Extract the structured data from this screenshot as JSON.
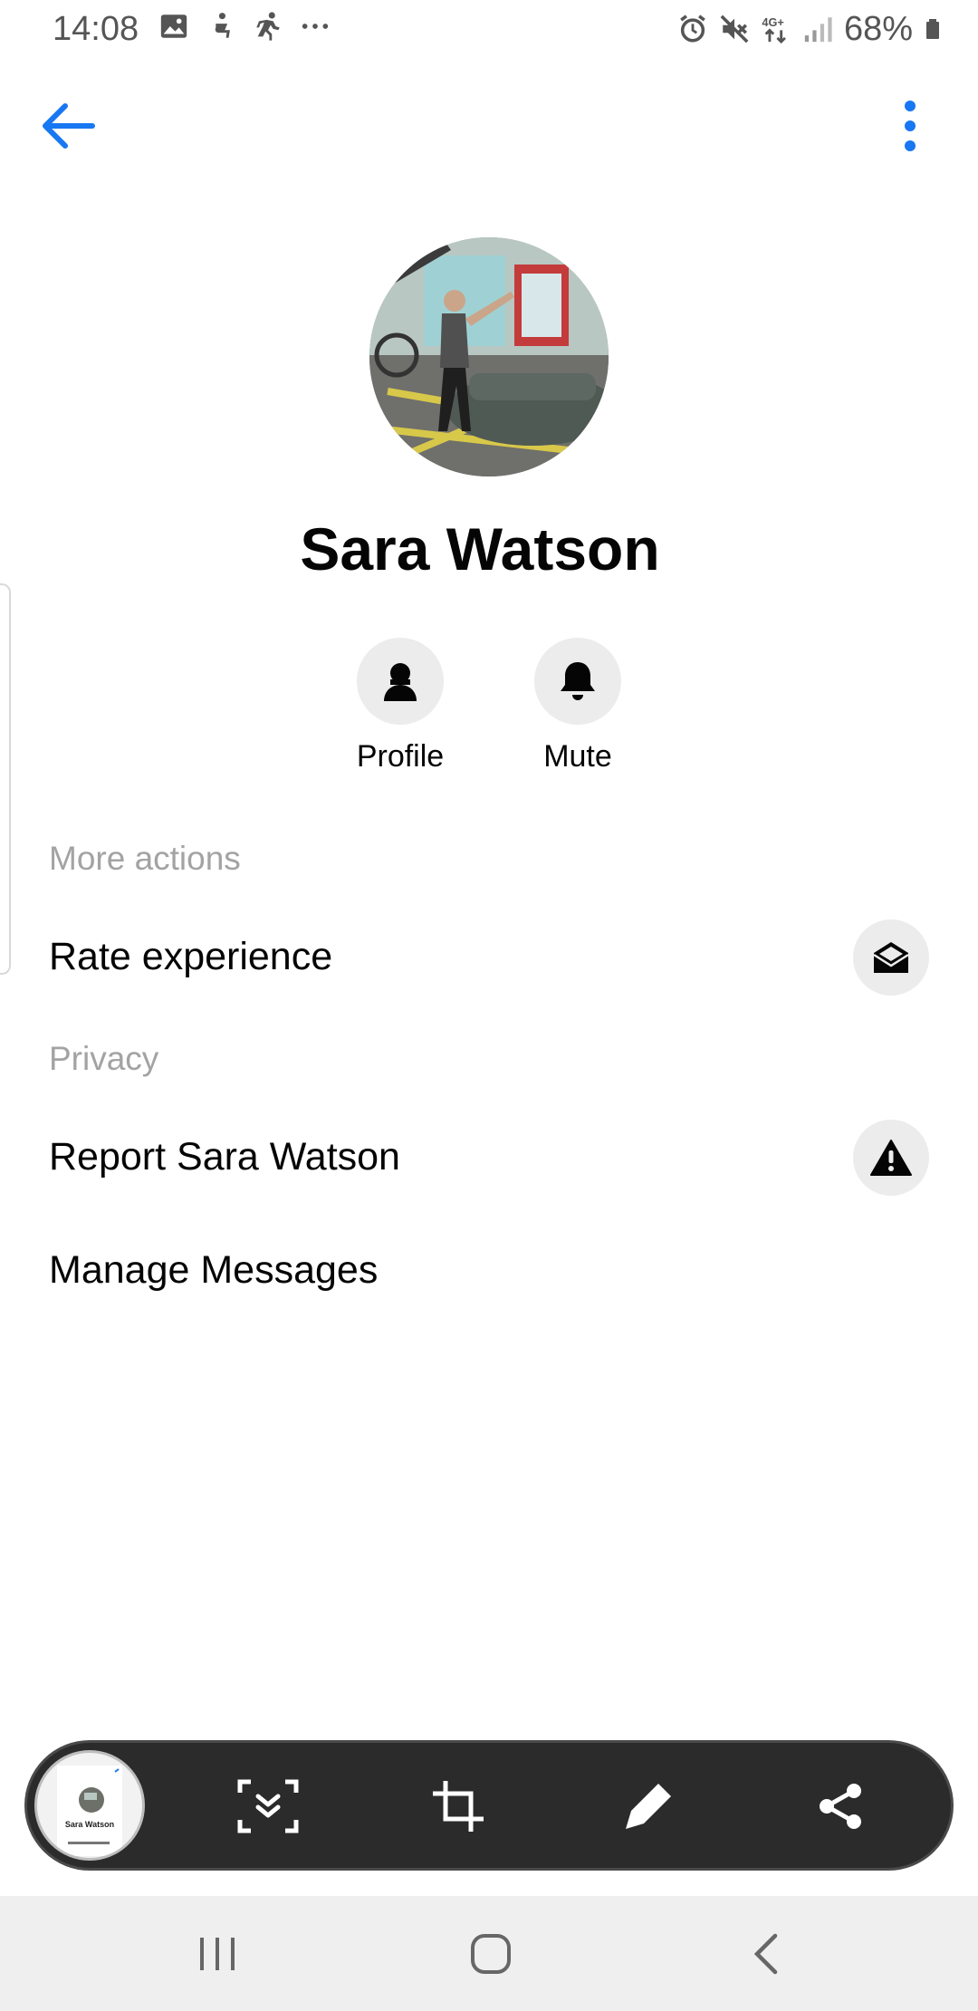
{
  "status_bar": {
    "time": "14:08",
    "battery_percent": "68%",
    "network": "4G+",
    "left_icons": [
      "gallery-icon",
      "accessibility-icon",
      "running-icon",
      "more-notifications-icon"
    ],
    "right_icons": [
      "alarm-icon",
      "mute-icon",
      "network-4g-icon",
      "signal-icon",
      "battery-icon"
    ]
  },
  "app_bar": {
    "back_icon": "arrow-left-icon",
    "menu_icon": "more-vertical-icon",
    "accent_color": "#1877f2"
  },
  "profile": {
    "name": "Sara Watson",
    "avatar": "profile-photo"
  },
  "actions": [
    {
      "label": "Profile",
      "icon": "person-icon"
    },
    {
      "label": "Mute",
      "icon": "bell-icon"
    }
  ],
  "sections": {
    "more_actions": {
      "header": "More actions",
      "items": [
        {
          "label": "Rate experience",
          "icon": "envelope-open-icon"
        }
      ]
    },
    "privacy": {
      "header": "Privacy",
      "items": [
        {
          "label": "Report Sara Watson",
          "icon": "warning-icon"
        },
        {
          "label": "Manage Messages"
        }
      ]
    }
  },
  "screenshot_toolbar": {
    "thumbnail_name": "Sara Watson",
    "buttons": [
      "scroll-capture-icon",
      "crop-icon",
      "draw-icon",
      "share-icon"
    ]
  },
  "nav_bar": {
    "buttons": [
      "recent-apps-icon",
      "home-icon",
      "back-icon"
    ]
  }
}
